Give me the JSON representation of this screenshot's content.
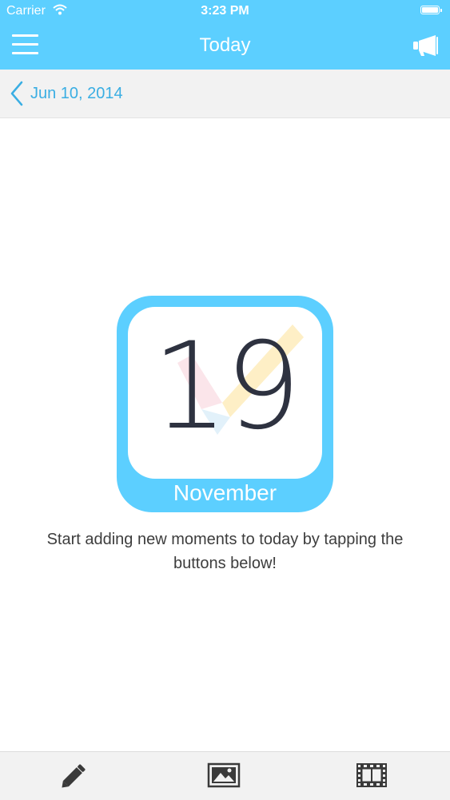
{
  "status_bar": {
    "carrier": "Carrier",
    "time": "3:23 PM"
  },
  "nav": {
    "title": "Today",
    "menu_icon": "hamburger-menu-icon",
    "right_icon": "megaphone-icon"
  },
  "date_bar": {
    "back_icon": "chevron-left-icon",
    "date": "Jun 10, 2014"
  },
  "calendar": {
    "day": "19",
    "month": "November"
  },
  "empty_message": "Start adding new moments to today by tapping the buttons below!",
  "toolbar": {
    "items": [
      {
        "icon": "pencil-icon",
        "action": "add-text"
      },
      {
        "icon": "image-icon",
        "action": "add-photo"
      },
      {
        "icon": "film-icon",
        "action": "add-video"
      }
    ]
  },
  "colors": {
    "accent": "#5ccfff",
    "link": "#3aaee3",
    "text": "#3d3d3d",
    "dark": "#2e3240",
    "bar": "#f2f2f2"
  }
}
